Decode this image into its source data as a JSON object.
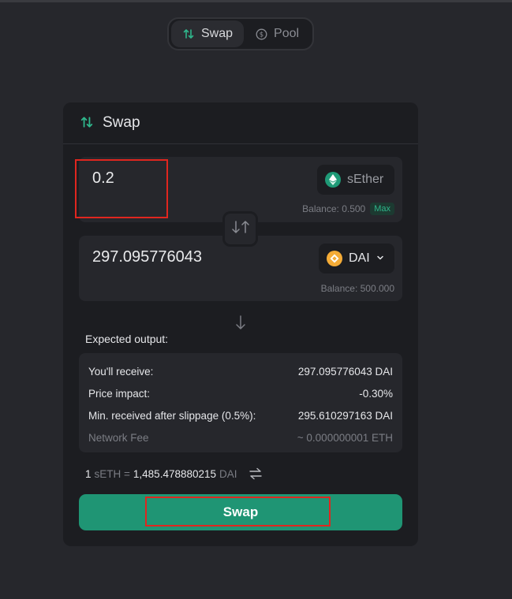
{
  "nav": {
    "tabs": [
      {
        "label": "Swap",
        "icon": "swap-icon",
        "active": true
      },
      {
        "label": "Pool",
        "icon": "coin-icon",
        "active": false
      }
    ]
  },
  "card": {
    "title": "Swap",
    "from": {
      "amount": "0.2",
      "token": "sEther",
      "token_icon": "ethereum-icon",
      "balance": "Balance: 0.500",
      "max_label": "Max"
    },
    "to": {
      "amount": "297.095776043",
      "token": "DAI",
      "token_icon": "dai-icon",
      "balance": "Balance: 500.000"
    },
    "expected_output_label": "Expected output:",
    "details": [
      {
        "label": "You'll receive:",
        "value": "297.095776043 DAI"
      },
      {
        "label": "Price impact:",
        "value": "-0.30%"
      },
      {
        "label": "Min. received after slippage (0.5%):",
        "value": "295.610297163 DAI"
      },
      {
        "label": "Network Fee",
        "value": "~ 0.000000001 ETH"
      }
    ],
    "rate": {
      "base_amount": "1",
      "base_token": "sETH =",
      "quote_amount": "1,485.478880215",
      "quote_token": "DAI"
    },
    "submit_label": "Swap"
  },
  "colors": {
    "accent": "#1f9574",
    "background": "#26272c",
    "card": "#1c1d21",
    "highlight": "#e0261f"
  }
}
